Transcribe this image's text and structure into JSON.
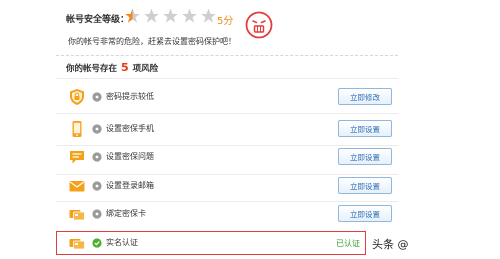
{
  "security": {
    "level_label": "帐号安全等级：",
    "score": "5分",
    "rating_out_of_5": 0.5,
    "danger_message": "你的帐号非常的危险，赶紧去设置密码保护吧！"
  },
  "risks": {
    "title_prefix": "你的帐号存在",
    "count": "5",
    "title_suffix": "项风险"
  },
  "items": [
    {
      "label": "密码提示较低",
      "action": "立即修改",
      "icon": "shield-icon",
      "status": "warning"
    },
    {
      "label": "设置密保手机",
      "action": "立即设置",
      "icon": "phone-icon",
      "status": "warning"
    },
    {
      "label": "设置密保问题",
      "action": "立即设置",
      "icon": "chat-bubble-icon",
      "status": "warning"
    },
    {
      "label": "设置登录邮箱",
      "action": "立即设置",
      "icon": "envelope-icon",
      "status": "warning"
    },
    {
      "label": "绑定密保卡",
      "action": "立即设置",
      "icon": "cards-icon",
      "status": "warning"
    }
  ],
  "verified": {
    "label": "实名认证",
    "status": "已认证",
    "icon": "id-card-icon"
  },
  "watermark": {
    "text": "头条 @"
  },
  "colors": {
    "accent_blue": "#2d6fb6",
    "danger_red": "#e8380d",
    "success_green": "#3a9a2c",
    "star_orange": "#f08a1c"
  }
}
